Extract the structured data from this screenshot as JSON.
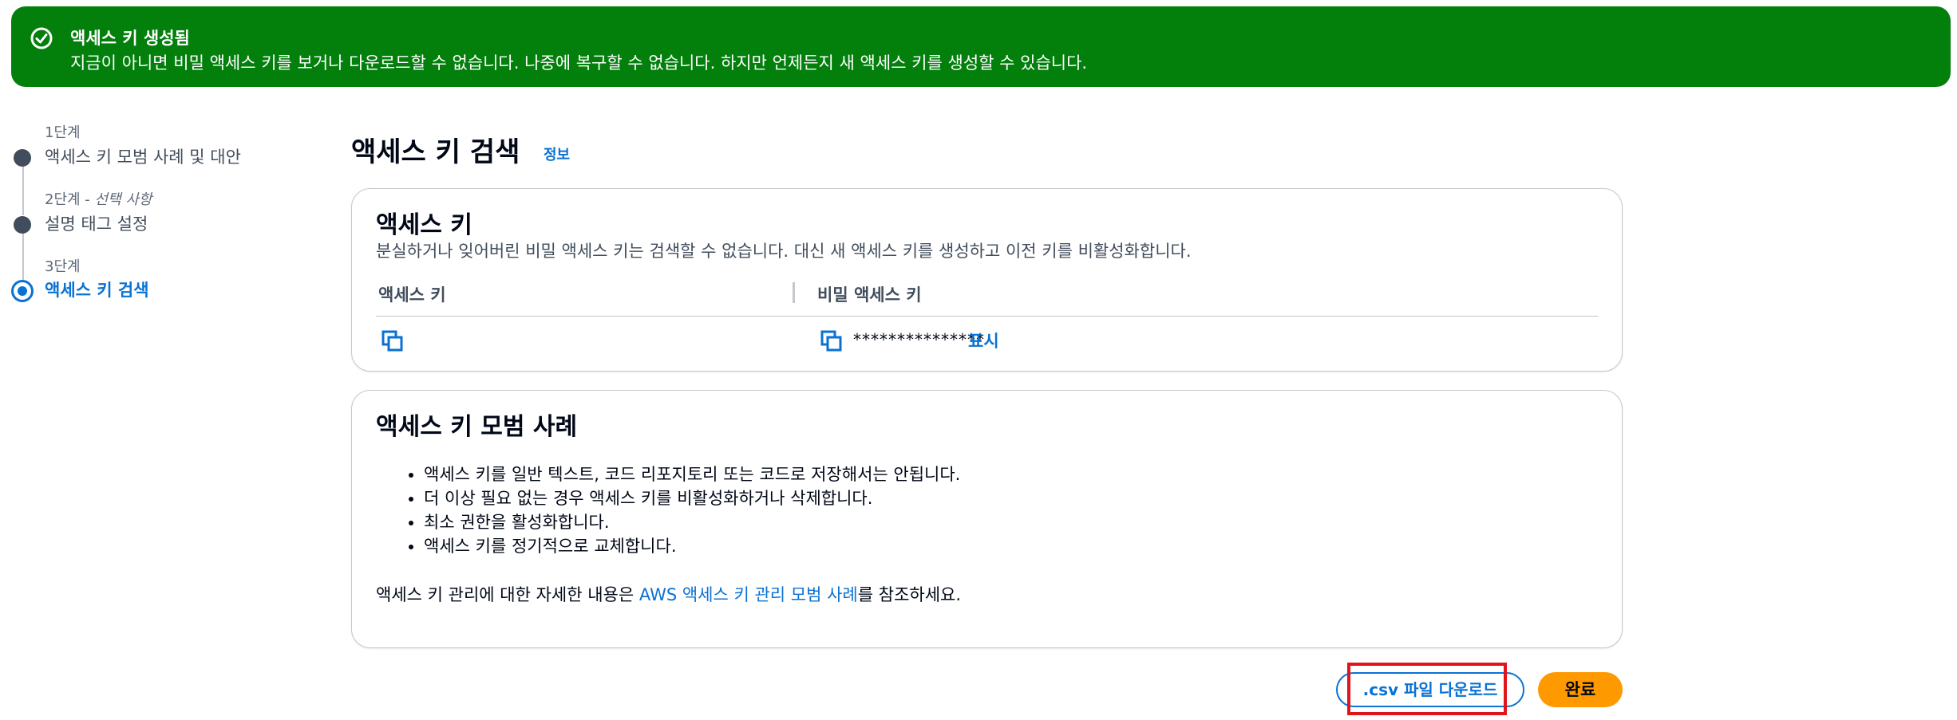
{
  "flash": {
    "title": "액세스 키 생성됨",
    "message": "지금이 아니면 비밀 액세스 키를 보거나 다운로드할 수 없습니다. 나중에 복구할 수 없습니다. 하지만 언제든지 새 액세스 키를 생성할 수 있습니다.",
    "icon": "check-circle-icon",
    "color": "#037f0c"
  },
  "steps": [
    {
      "number": "1단계",
      "optional": "",
      "title": "액세스 키 모범 사례 및 대안",
      "state": "completed"
    },
    {
      "number": "2단계",
      "optional": "선택 사항",
      "title": "설명 태그 설정",
      "state": "completed"
    },
    {
      "number": "3단계",
      "optional": "",
      "title": "액세스 키 검색",
      "state": "current"
    }
  ],
  "step_separator": " - ",
  "header": {
    "title": "액세스 키 검색",
    "info_link": "정보"
  },
  "access_key_panel": {
    "title": "액세스 키",
    "description": "분실하거나 잊어버린 비밀 액세스 키는 검색할 수 없습니다. 대신 새 액세스 키를 생성하고 이전 키를 비활성화합니다.",
    "columns": [
      "액세스 키",
      "비밀 액세스 키"
    ],
    "access_key_value": "",
    "secret_key_masked": "***************",
    "show_label": "표시"
  },
  "best_practices_panel": {
    "title": "액세스 키 모범 사례",
    "items": [
      "액세스 키를 일반 텍스트, 코드 리포지토리 또는 코드로 저장해서는 안됩니다.",
      "더 이상 필요 없는 경우 액세스 키를 비활성화하거나 삭제합니다.",
      "최소 권한을 활성화합니다.",
      "액세스 키를 정기적으로 교체합니다."
    ],
    "footer_prefix": "액세스 키 관리에 대한 자세한 내용은 ",
    "footer_link": "AWS 액세스 키 관리 모범 사례",
    "footer_suffix": "를 참조하세요."
  },
  "actions": {
    "download_csv": ".csv 파일 다운로드",
    "done": "완료"
  },
  "colors": {
    "accent": "#0972d3",
    "primary_button": "#ff9900",
    "highlight": "#e1141c"
  }
}
